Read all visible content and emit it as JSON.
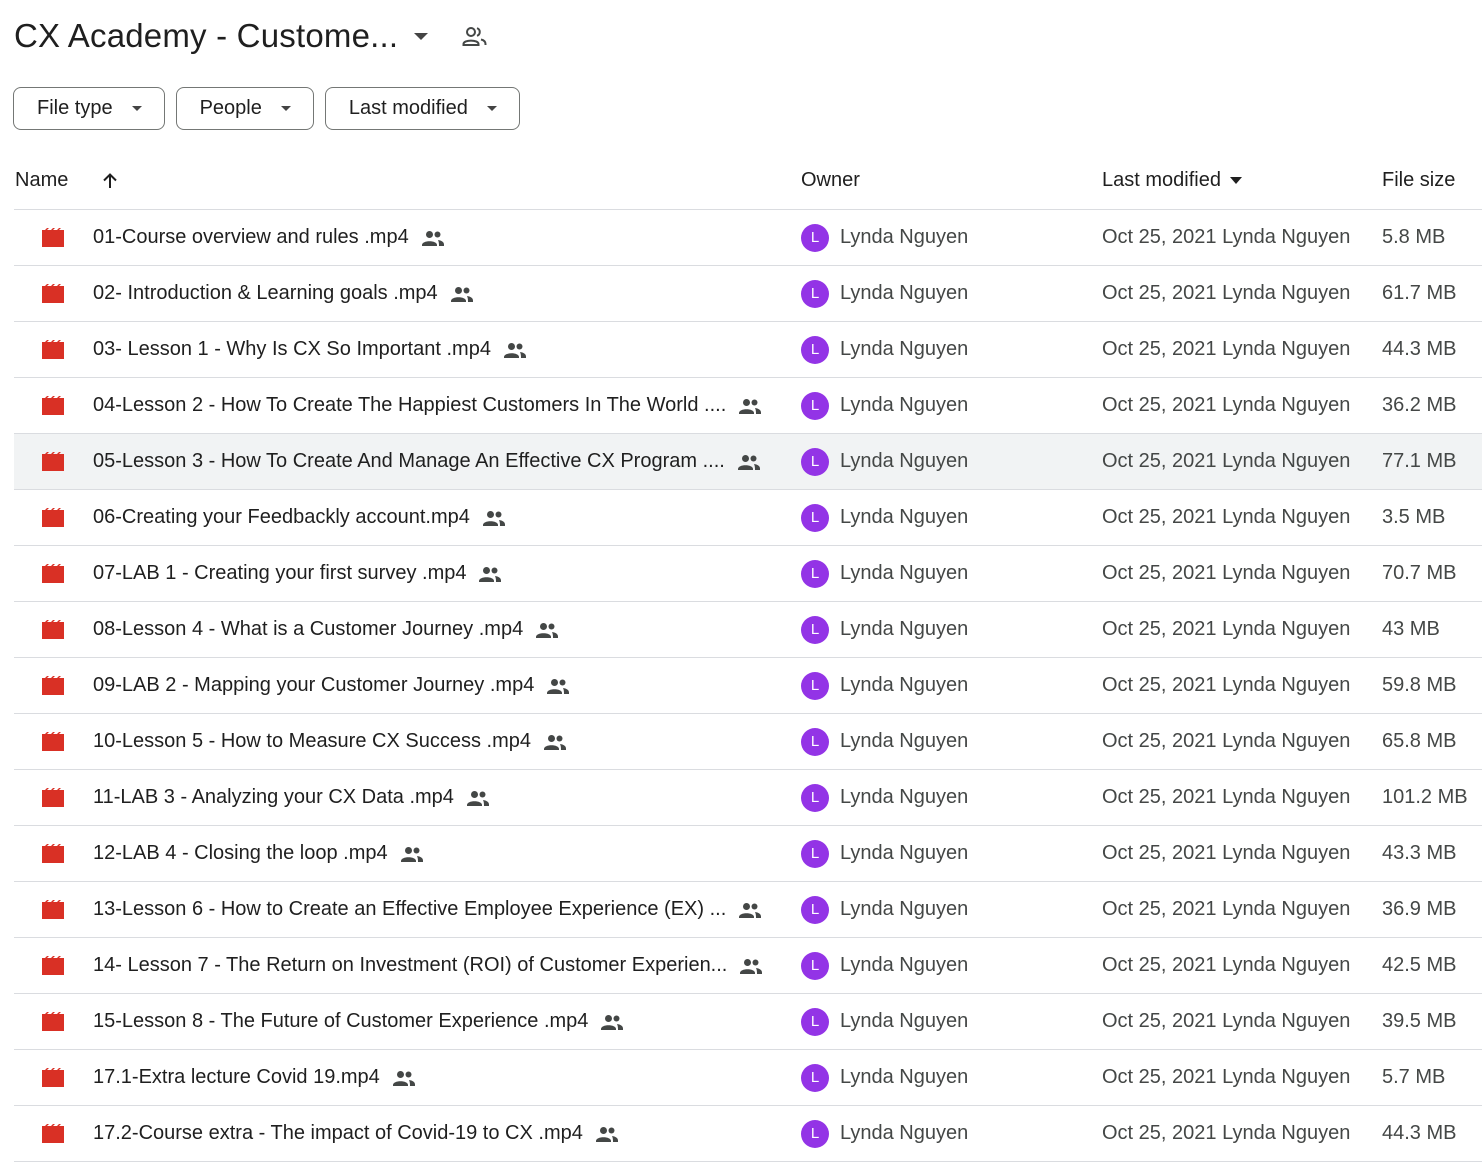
{
  "folder": {
    "title": "CX Academy - Custome...",
    "caret_icon": "arrow-drop-down-icon",
    "shared_icon": "people-outline-icon"
  },
  "filters": [
    {
      "label": "File type",
      "icon": "arrow-drop-down-icon"
    },
    {
      "label": "People",
      "icon": "arrow-drop-down-icon"
    },
    {
      "label": "Last modified",
      "icon": "arrow-drop-down-icon"
    }
  ],
  "table": {
    "columns": {
      "name": "Name",
      "owner": "Owner",
      "last_modified": "Last modified",
      "file_size": "File size"
    },
    "sort_icon": "arrow-upward-icon",
    "rows": [
      {
        "name": "01-Course overview and rules .mp4",
        "owner": "Lynda Nguyen",
        "avatar": "L",
        "modified": "Oct 25, 2021 Lynda Nguyen",
        "size": "5.8 MB"
      },
      {
        "name": "02- Introduction & Learning goals .mp4",
        "owner": "Lynda Nguyen",
        "avatar": "L",
        "modified": "Oct 25, 2021 Lynda Nguyen",
        "size": "61.7 MB"
      },
      {
        "name": "03- Lesson 1 - Why Is CX So Important .mp4",
        "owner": "Lynda Nguyen",
        "avatar": "L",
        "modified": "Oct 25, 2021 Lynda Nguyen",
        "size": "44.3 MB"
      },
      {
        "name": "04-Lesson 2 - How To Create The Happiest Customers In The World ....",
        "owner": "Lynda Nguyen",
        "avatar": "L",
        "modified": "Oct 25, 2021 Lynda Nguyen",
        "size": "36.2 MB"
      },
      {
        "name": "05-Lesson 3 - How To Create And Manage An Effective CX Program ....",
        "owner": "Lynda Nguyen",
        "avatar": "L",
        "modified": "Oct 25, 2021 Lynda Nguyen",
        "size": "77.1 MB",
        "selected": true
      },
      {
        "name": "06-Creating your Feedbackly account.mp4",
        "owner": "Lynda Nguyen",
        "avatar": "L",
        "modified": "Oct 25, 2021 Lynda Nguyen",
        "size": "3.5 MB"
      },
      {
        "name": "07-LAB 1 - Creating your first survey .mp4",
        "owner": "Lynda Nguyen",
        "avatar": "L",
        "modified": "Oct 25, 2021 Lynda Nguyen",
        "size": "70.7 MB"
      },
      {
        "name": "08-Lesson 4 - What is a Customer Journey .mp4",
        "owner": "Lynda Nguyen",
        "avatar": "L",
        "modified": "Oct 25, 2021 Lynda Nguyen",
        "size": "43 MB"
      },
      {
        "name": "09-LAB 2 - Mapping your Customer Journey .mp4",
        "owner": "Lynda Nguyen",
        "avatar": "L",
        "modified": "Oct 25, 2021 Lynda Nguyen",
        "size": "59.8 MB"
      },
      {
        "name": "10-Lesson 5 - How to Measure CX Success .mp4",
        "owner": "Lynda Nguyen",
        "avatar": "L",
        "modified": "Oct 25, 2021 Lynda Nguyen",
        "size": "65.8 MB"
      },
      {
        "name": "11-LAB 3 - Analyzing your CX Data .mp4",
        "owner": "Lynda Nguyen",
        "avatar": "L",
        "modified": "Oct 25, 2021 Lynda Nguyen",
        "size": "101.2 MB"
      },
      {
        "name": "12-LAB 4 - Closing the loop .mp4",
        "owner": "Lynda Nguyen",
        "avatar": "L",
        "modified": "Oct 25, 2021 Lynda Nguyen",
        "size": "43.3 MB"
      },
      {
        "name": "13-Lesson 6 - How to Create an Effective Employee Experience (EX) ...",
        "owner": "Lynda Nguyen",
        "avatar": "L",
        "modified": "Oct 25, 2021 Lynda Nguyen",
        "size": "36.9 MB"
      },
      {
        "name": "14- Lesson 7 - The Return on Investment (ROI) of Customer Experien...",
        "owner": "Lynda Nguyen",
        "avatar": "L",
        "modified": "Oct 25, 2021 Lynda Nguyen",
        "size": "42.5 MB"
      },
      {
        "name": "15-Lesson 8 - The Future of Customer Experience .mp4",
        "owner": "Lynda Nguyen",
        "avatar": "L",
        "modified": "Oct 25, 2021 Lynda Nguyen",
        "size": "39.5 MB"
      },
      {
        "name": "17.1-Extra lecture Covid 19.mp4",
        "owner": "Lynda Nguyen",
        "avatar": "L",
        "modified": "Oct 25, 2021 Lynda Nguyen",
        "size": "5.7 MB"
      },
      {
        "name": "17.2-Course extra - The impact of Covid-19 to CX .mp4",
        "owner": "Lynda Nguyen",
        "avatar": "L",
        "modified": "Oct 25, 2021 Lynda Nguyen",
        "size": "44.3 MB"
      }
    ]
  },
  "colors": {
    "video_icon": "#d93025",
    "avatar": "#9334e6",
    "selected_row": "#f1f3f4",
    "divider": "#dadce0"
  }
}
